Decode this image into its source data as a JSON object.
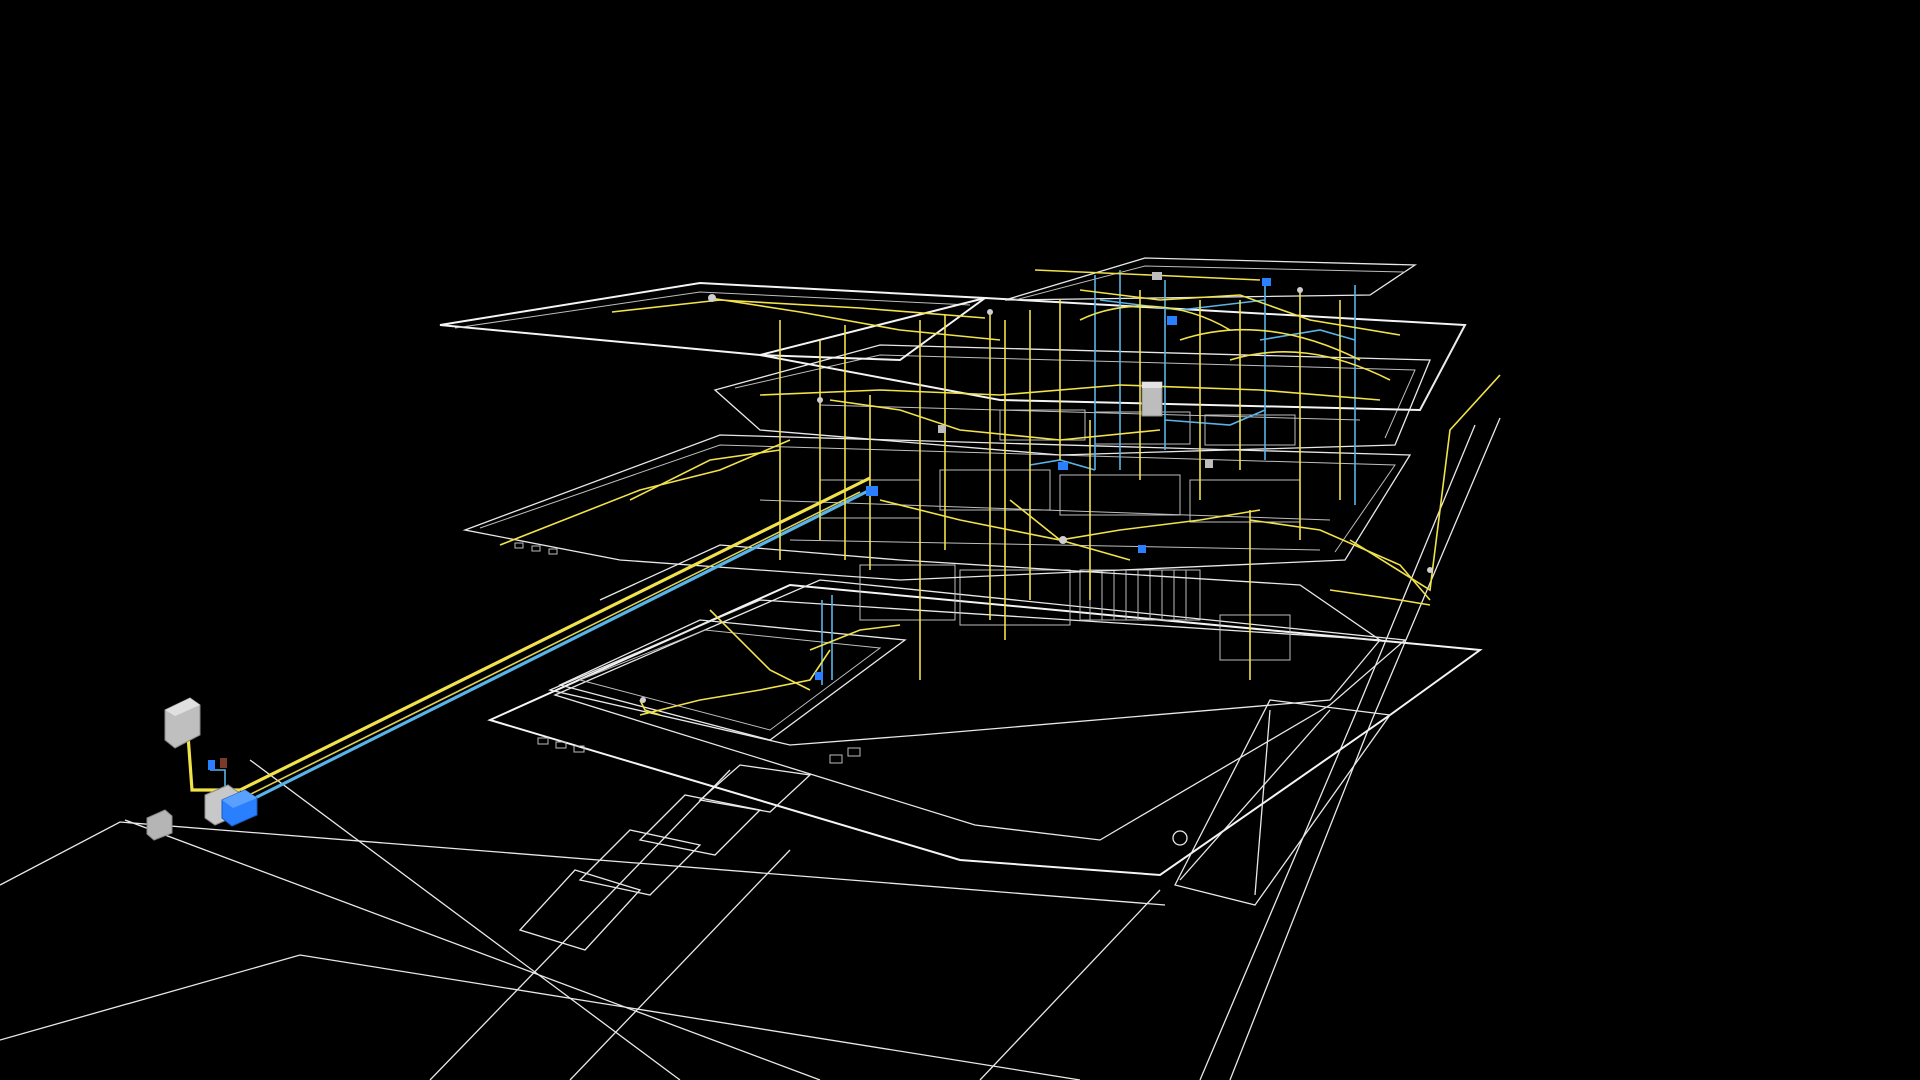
{
  "scene": {
    "view": "3d-wireframe-isometric",
    "background": "#000000",
    "line_color": "#ffffff",
    "colors": {
      "electrical": "#f2e24a",
      "plumbing": "#58b4e8",
      "equipment": "#bfbfbf",
      "equipment_blue": "#2a7fff",
      "equipment_dark": "#7a3a2a"
    },
    "layers": [
      "electrical",
      "plumbing",
      "floor-outline",
      "equipment"
    ],
    "floors": 4
  }
}
